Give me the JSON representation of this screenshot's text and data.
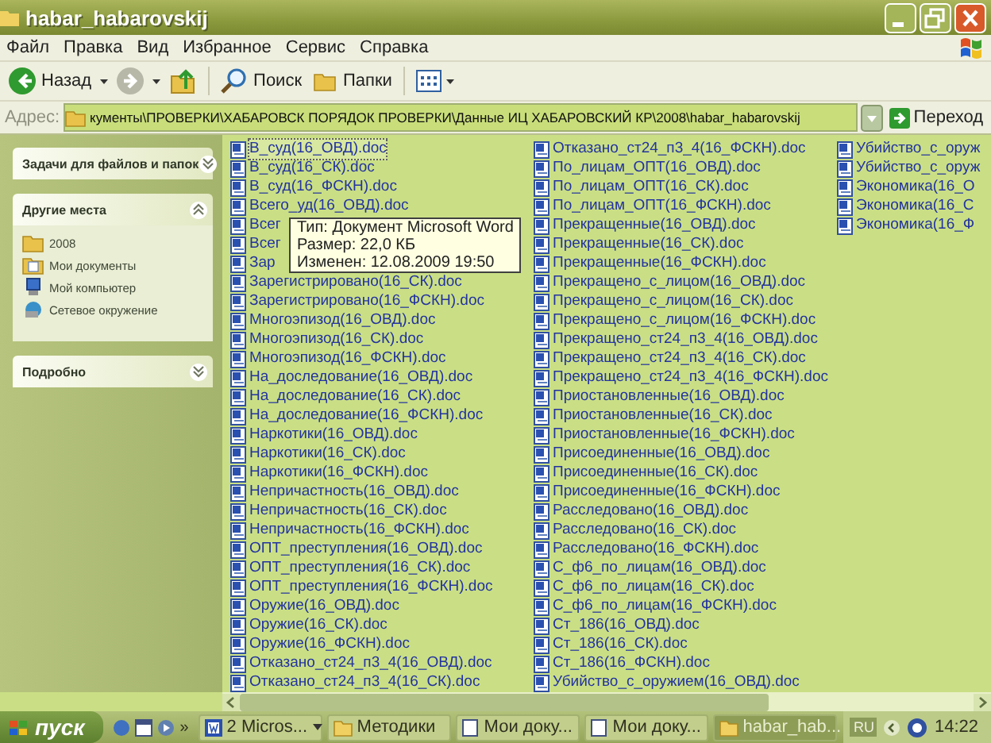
{
  "window": {
    "title": "habar_habarovskij"
  },
  "menu": [
    "Файл",
    "Правка",
    "Вид",
    "Избранное",
    "Сервис",
    "Справка"
  ],
  "toolbar": [
    {
      "kind": "back",
      "label": "Назад",
      "disabled": false
    },
    {
      "kind": "forward",
      "disabled": true
    },
    {
      "kind": "up",
      "disabled": false
    },
    {
      "kind": "search",
      "label": "Поиск"
    },
    {
      "kind": "folders",
      "label": "Папки"
    },
    {
      "kind": "views"
    }
  ],
  "address": {
    "label": "Адрес:",
    "value": "кументы\\ПРОВЕРКИ\\ХАБАРОВСК ПОРЯДОК ПРОВЕРКИ\\Данные ИЦ ХАБАРОВСКИЙ КР\\2008\\habar_habarovskij",
    "go": "Переход"
  },
  "sidebar": {
    "panels": [
      {
        "title": "Задачи для файлов и папок",
        "expanded": false
      },
      {
        "title": "Другие места",
        "expanded": true,
        "items": [
          {
            "label": "2008",
            "kind": "folder"
          },
          {
            "label": "Мои документы",
            "kind": "documents"
          },
          {
            "label": "Мой компьютер",
            "kind": "computer"
          },
          {
            "label": "Сетевое окружение",
            "kind": "network"
          }
        ]
      },
      {
        "title": "Подробно",
        "expanded": false
      }
    ]
  },
  "files": [
    {
      "name": "В_суд(16_ОВД).doc",
      "selected": true
    },
    {
      "name": "В_суд(16_СК).doc",
      "selected": false
    },
    {
      "name": "В_суд(16_ФСКН).doc",
      "selected": false
    },
    {
      "name": "Всего_уд(16_ОВД).doc",
      "selected": false
    },
    {
      "name": "Всег",
      "selected": false
    },
    {
      "name": "Всег",
      "selected": false
    },
    {
      "name": "Зар",
      "selected": false
    },
    {
      "name": "Зарегистрировано(16_СК).doc",
      "selected": false
    },
    {
      "name": "Зарегистрировано(16_ФСКН).doc",
      "selected": false
    },
    {
      "name": "Многоэпизод(16_ОВД).doc",
      "selected": false
    },
    {
      "name": "Многоэпизод(16_СК).doc",
      "selected": false
    },
    {
      "name": "Многоэпизод(16_ФСКН).doc",
      "selected": false
    },
    {
      "name": "На_доследование(16_ОВД).doc",
      "selected": false
    },
    {
      "name": "На_доследование(16_СК).doc",
      "selected": false
    },
    {
      "name": "На_доследование(16_ФСКН).doc",
      "selected": false
    },
    {
      "name": "Наркотики(16_ОВД).doc",
      "selected": false
    },
    {
      "name": "Наркотики(16_СК).doc",
      "selected": false
    },
    {
      "name": "Наркотики(16_ФСКН).doc",
      "selected": false
    },
    {
      "name": "Непричастность(16_ОВД).doc",
      "selected": false
    },
    {
      "name": "Непричастность(16_СК).doc",
      "selected": false
    },
    {
      "name": "Непричастность(16_ФСКН).doc",
      "selected": false
    },
    {
      "name": "ОПТ_преступления(16_ОВД).doc",
      "selected": false
    },
    {
      "name": "ОПТ_преступления(16_СК).doc",
      "selected": false
    },
    {
      "name": "ОПТ_преступления(16_ФСКН).doc",
      "selected": false
    },
    {
      "name": "Оружие(16_ОВД).doc",
      "selected": false
    },
    {
      "name": "Оружие(16_СК).doc",
      "selected": false
    },
    {
      "name": "Оружие(16_ФСКН).doc",
      "selected": false
    },
    {
      "name": "Отказано_ст24_п3_4(16_ОВД).doc",
      "selected": false
    },
    {
      "name": "Отказано_ст24_п3_4(16_СК).doc",
      "selected": false
    },
    {
      "name": "Отказано_ст24_п3_4(16_ФСКН).doc",
      "selected": false
    },
    {
      "name": "По_лицам_ОПТ(16_ОВД).doc",
      "selected": false
    },
    {
      "name": "По_лицам_ОПТ(16_СК).doc",
      "selected": false
    },
    {
      "name": "По_лицам_ОПТ(16_ФСКН).doc",
      "selected": false
    },
    {
      "name": "Прекращенные(16_ОВД).doc",
      "selected": false
    },
    {
      "name": "Прекращенные(16_СК).doc",
      "selected": false
    },
    {
      "name": "Прекращенные(16_ФСКН).doc",
      "selected": false
    },
    {
      "name": "Прекращено_с_лицом(16_ОВД).doc",
      "selected": false
    },
    {
      "name": "Прекращено_с_лицом(16_СК).doc",
      "selected": false
    },
    {
      "name": "Прекращено_с_лицом(16_ФСКН).doc",
      "selected": false
    },
    {
      "name": "Прекращено_ст24_п3_4(16_ОВД).doc",
      "selected": false
    },
    {
      "name": "Прекращено_ст24_п3_4(16_СК).doc",
      "selected": false
    },
    {
      "name": "Прекращено_ст24_п3_4(16_ФСКН).doc",
      "selected": false
    },
    {
      "name": "Приостановленные(16_ОВД).doc",
      "selected": false
    },
    {
      "name": "Приостановленные(16_СК).doc",
      "selected": false
    },
    {
      "name": "Приостановленные(16_ФСКН).doc",
      "selected": false
    },
    {
      "name": "Присоединенные(16_ОВД).doc",
      "selected": false
    },
    {
      "name": "Присоединенные(16_СК).doc",
      "selected": false
    },
    {
      "name": "Присоединенные(16_ФСКН).doc",
      "selected": false
    },
    {
      "name": "Расследовано(16_ОВД).doc",
      "selected": false
    },
    {
      "name": "Расследовано(16_СК).doc",
      "selected": false
    },
    {
      "name": "Расследовано(16_ФСКН).doc",
      "selected": false
    },
    {
      "name": "С_ф6_по_лицам(16_ОВД).doc",
      "selected": false
    },
    {
      "name": "С_ф6_по_лицам(16_СК).doc",
      "selected": false
    },
    {
      "name": "С_ф6_по_лицам(16_ФСКН).doc",
      "selected": false
    },
    {
      "name": "Ст_186(16_ОВД).doc",
      "selected": false
    },
    {
      "name": "Ст_186(16_СК).doc",
      "selected": false
    },
    {
      "name": "Ст_186(16_ФСКН).doc",
      "selected": false
    },
    {
      "name": "Убийство_с_оружием(16_ОВД).doc",
      "selected": false
    },
    {
      "name": "Убийство_с_оруж",
      "selected": false
    },
    {
      "name": "Убийство_с_оруж",
      "selected": false
    },
    {
      "name": "Экономика(16_О",
      "selected": false
    },
    {
      "name": "Экономика(16_С",
      "selected": false
    },
    {
      "name": "Экономика(16_Ф",
      "selected": false
    }
  ],
  "tooltip": {
    "lines": [
      "Тип: Документ Microsoft Word",
      "Размер: 22,0 КБ",
      "Изменен: 12.08.2009 19:50"
    ]
  },
  "taskbar": {
    "start": "пуск",
    "more": "»",
    "tasks": [
      {
        "label": "2 Micros...",
        "kind": "word-group",
        "selected": false
      },
      {
        "label": "Методики",
        "kind": "folder",
        "selected": false
      },
      {
        "label": "Мои доку...",
        "kind": "document",
        "selected": false
      },
      {
        "label": "Мои доку...",
        "kind": "document",
        "selected": false
      },
      {
        "label": "habar_hab...",
        "kind": "folder",
        "selected": true
      }
    ],
    "language": "RU",
    "clock": "14:22"
  }
}
